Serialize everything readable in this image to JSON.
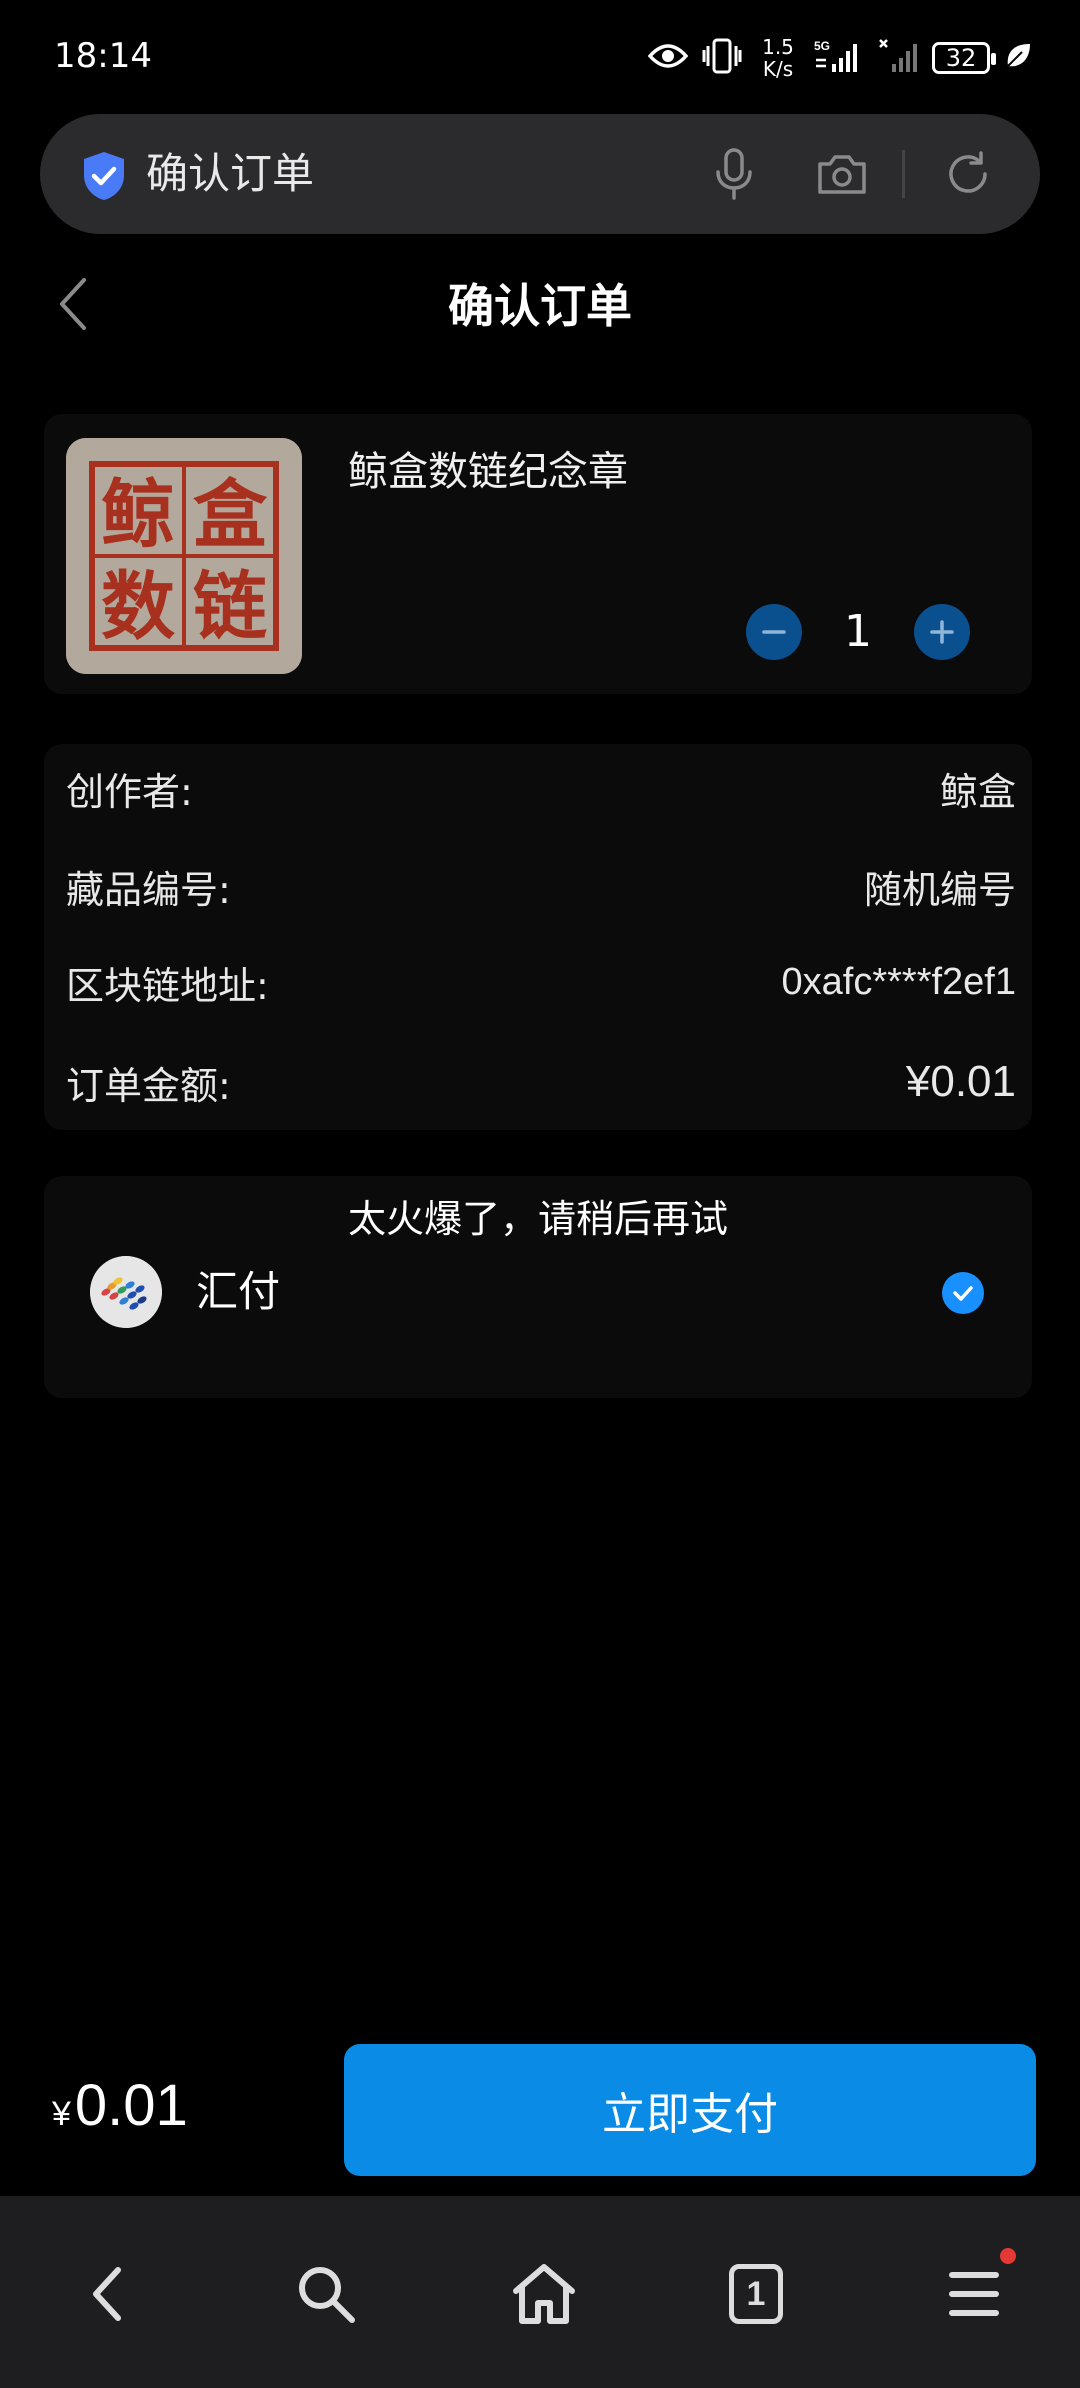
{
  "status_bar": {
    "time": "18:14",
    "net_speed_value": "1.5",
    "net_speed_unit": "K/s",
    "network_label": "5G",
    "battery_level": "32",
    "icons": [
      "eye-icon",
      "vibrate-icon",
      "signal-icon",
      "signal-weak-icon",
      "battery-icon",
      "leaf-icon"
    ]
  },
  "browser": {
    "address_title": "确认订单",
    "icons": [
      "shield-icon",
      "microphone-icon",
      "camera-icon",
      "refresh-icon"
    ]
  },
  "header": {
    "title": "确认订单"
  },
  "product": {
    "name": "鲸盒数链纪念章",
    "image_text": [
      "鲸",
      "盒",
      "数",
      "链"
    ],
    "quantity": "1"
  },
  "details": [
    {
      "label": "创作者:",
      "value": "鲸盒"
    },
    {
      "label": "藏品编号:",
      "value": "随机编号"
    },
    {
      "label": "区块链地址:",
      "value": "0xafc****f2ef1"
    },
    {
      "label": "订单金额:",
      "value": "¥0.01"
    }
  ],
  "payment": {
    "toast": "太火爆了，请稍后再试",
    "method": "汇付",
    "selected": true
  },
  "footer": {
    "currency": "¥",
    "total": "0.01",
    "pay_button": "立即支付"
  },
  "bottom_nav": {
    "tab_count": "1",
    "icons": [
      "back-icon",
      "search-icon",
      "home-icon",
      "tabs-icon",
      "menu-icon"
    ]
  },
  "colors": {
    "accent": "#0a8be6",
    "qty_button": "#0a4f8e",
    "card_bg": "#0b0b0b",
    "nav_bg": "#1e1e20",
    "seal_red": "#a8301e"
  }
}
